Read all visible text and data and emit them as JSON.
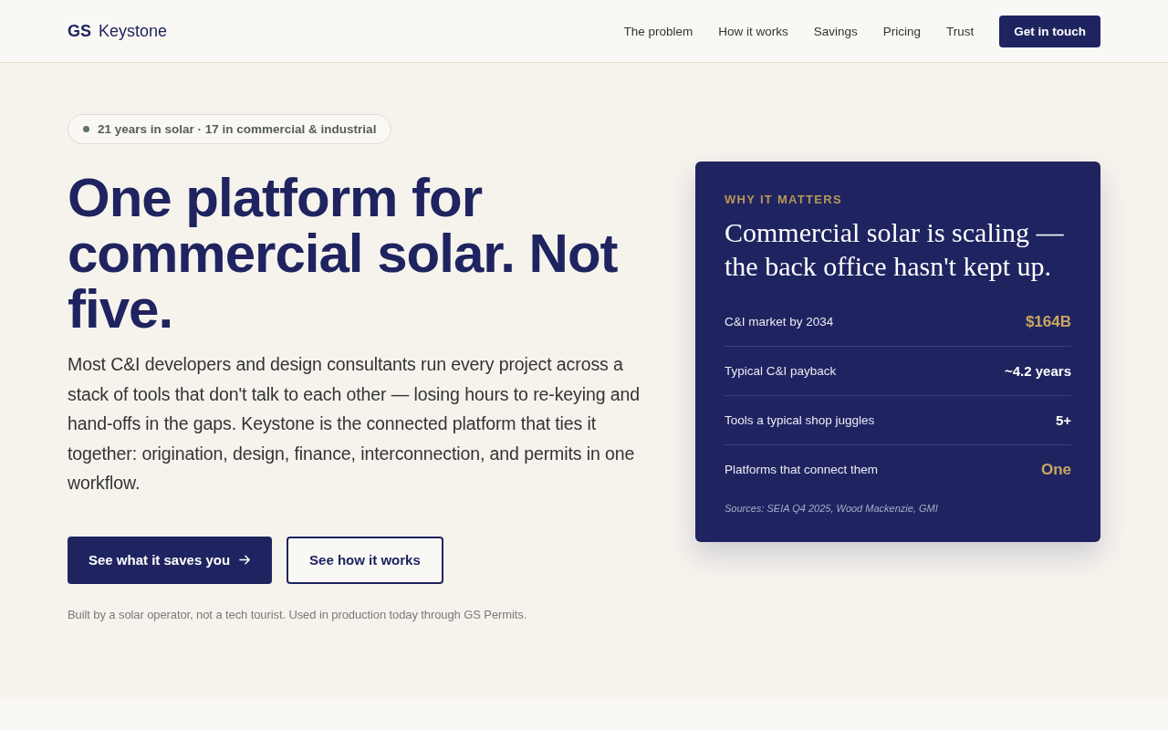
{
  "header": {
    "logo_mark": "GS",
    "logo_text": "Keystone",
    "nav": [
      "The problem",
      "How it works",
      "Savings",
      "Pricing",
      "Trust"
    ],
    "cta": "Get in touch"
  },
  "hero": {
    "badge": "21 years in solar · 17 in commercial & industrial",
    "title": "One platform for commercial solar. Not five.",
    "body": "Most C&I developers and design consultants run every project across a stack of tools that don't talk to each other — losing hours to re-keying and hand-offs in the gaps. Keystone is the connected platform that ties it together: origination, design, finance, interconnection, and permits in one workflow.",
    "buttons": [
      {
        "label": "See what it saves you",
        "kind": "primary"
      },
      {
        "label": "See how it works",
        "kind": "secondary"
      }
    ],
    "note": "Built by a solar operator, not a tech tourist. Used in production today through GS Permits."
  },
  "card": {
    "eyebrow": "WHY IT MATTERS",
    "title": "Commercial solar is scaling — the back office hasn't kept up.",
    "stats": [
      {
        "label": "C&I market by 2034",
        "value": "$164B",
        "highlight": true
      },
      {
        "label": "Typical C&I payback",
        "value": "~4.2 years",
        "highlight": false
      },
      {
        "label": "Tools a typical shop juggles",
        "value": "5+",
        "highlight": false
      },
      {
        "label": "Platforms that connect them",
        "value": "One",
        "highlight": true
      }
    ],
    "sources": "Sources: SEIA Q4 2025, Wood Mackenzie, GMI"
  }
}
